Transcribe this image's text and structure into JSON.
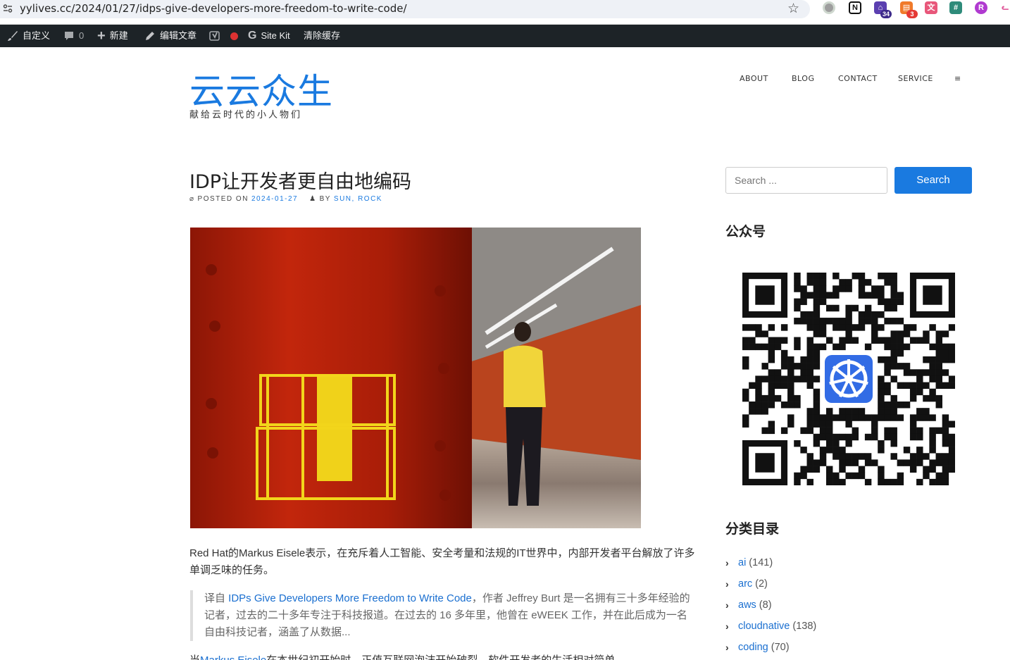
{
  "browser": {
    "url": "yylives.cc/2024/01/27/idps-give-developers-more-freedom-to-write-code/",
    "extension_badges": [
      "34",
      "3"
    ]
  },
  "adminbar": {
    "customize": "自定义",
    "comments_count": "0",
    "new": "新建",
    "edit": "编辑文章",
    "sitekit": "Site Kit",
    "clear_cache": "清除缓存"
  },
  "site": {
    "title": "云云众生",
    "tagline": "献给云时代的小人物们"
  },
  "nav": {
    "items": [
      "ABOUT",
      "BLOG",
      "CONTACT",
      "SERVICE",
      "≡"
    ]
  },
  "post": {
    "title": "IDP让开发者更自由地编码",
    "posted_on_label": "POSTED ON",
    "date": "2024-01-27",
    "by_label": "BY",
    "author": "SUN, ROCK",
    "intro": "Red Hat的Markus Eisele表示，在充斥着人工智能、安全考量和法规的IT世界中，内部开发者平台解放了许多单调乏味的任务。",
    "quote_prefix": "译自 ",
    "quote_link": "IDPs Give Developers More Freedom to Write Code",
    "quote_rest": "，作者 Jeffrey Burt 是一名拥有三十多年经验的记者，过去的二十多年专注于科技报道。在过去的 16 多年里，他曾在 eWEEK 工作，并在此后成为一名自由科技记者，涵盖了从数据...",
    "cut_prefix": "当",
    "cut_link": "Markus Eisele",
    "cut_rest": "在本世纪初开始时，正值互联网泡沫开始破裂，软件开发者的生活相对简单"
  },
  "sidebar": {
    "search_placeholder": "Search ...",
    "search_button": "Search",
    "wechat_title": "公众号",
    "categories_title": "分类目录",
    "categories": [
      {
        "name": "ai",
        "count": "(141)"
      },
      {
        "name": "arc",
        "count": "(2)"
      },
      {
        "name": "aws",
        "count": "(8)"
      },
      {
        "name": "cloudnative",
        "count": "(138)"
      },
      {
        "name": "coding",
        "count": "(70)"
      }
    ]
  },
  "colors": {
    "accent": "#1a7ae0",
    "adminbar": "#1d2327"
  }
}
